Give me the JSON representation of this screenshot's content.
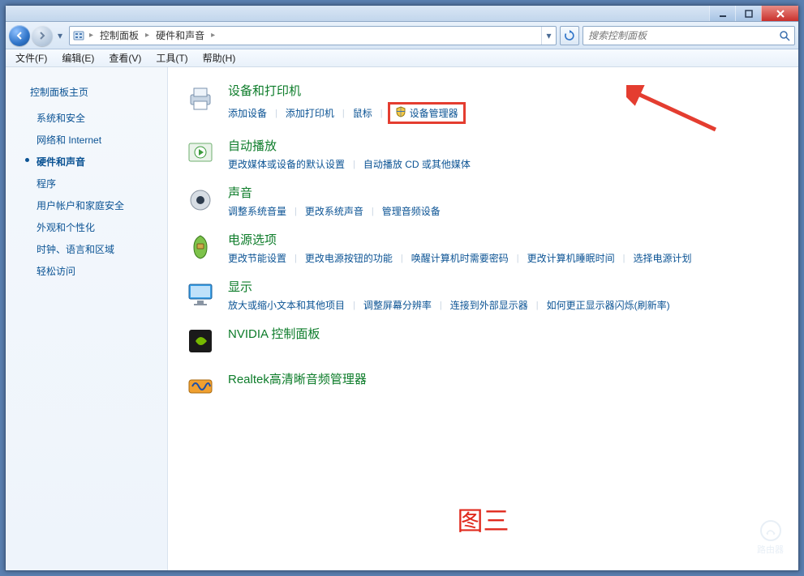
{
  "chrome": {
    "min_icon": "min",
    "max_icon": "max",
    "close_icon": "close"
  },
  "breadcrumb": {
    "root_icon": "control-panel",
    "level1": "控制面板",
    "level2": "硬件和声音"
  },
  "refresh_icon": "refresh",
  "search": {
    "placeholder": "搜索控制面板"
  },
  "menu": {
    "file": "文件(F)",
    "edit": "编辑(E)",
    "view": "查看(V)",
    "tools": "工具(T)",
    "help": "帮助(H)"
  },
  "sidebar": {
    "home": "控制面板主页",
    "items": [
      {
        "label": "系统和安全",
        "active": false
      },
      {
        "label": "网络和 Internet",
        "active": false
      },
      {
        "label": "硬件和声音",
        "active": true
      },
      {
        "label": "程序",
        "active": false
      },
      {
        "label": "用户帐户和家庭安全",
        "active": false
      },
      {
        "label": "外观和个性化",
        "active": false
      },
      {
        "label": "时钟、语言和区域",
        "active": false
      },
      {
        "label": "轻松访问",
        "active": false
      }
    ]
  },
  "categories": [
    {
      "icon": "printer",
      "title": "设备和打印机",
      "links": [
        {
          "t": "添加设备"
        },
        {
          "t": "添加打印机"
        },
        {
          "t": "鼠标"
        },
        {
          "t": "设备管理器",
          "shield": true,
          "highlight": true
        }
      ]
    },
    {
      "icon": "autoplay",
      "title": "自动播放",
      "links": [
        {
          "t": "更改媒体或设备的默认设置"
        },
        {
          "t": "自动播放 CD 或其他媒体"
        }
      ]
    },
    {
      "icon": "sound",
      "title": "声音",
      "links": [
        {
          "t": "调整系统音量"
        },
        {
          "t": "更改系统声音"
        },
        {
          "t": "管理音频设备"
        }
      ]
    },
    {
      "icon": "power",
      "title": "电源选项",
      "links": [
        {
          "t": "更改节能设置"
        },
        {
          "t": "更改电源按钮的功能"
        },
        {
          "t": "唤醒计算机时需要密码"
        },
        {
          "t": "更改计算机睡眠时间"
        },
        {
          "t": "选择电源计划"
        }
      ]
    },
    {
      "icon": "display",
      "title": "显示",
      "links": [
        {
          "t": "放大或缩小文本和其他项目"
        },
        {
          "t": "调整屏幕分辨率"
        },
        {
          "t": "连接到外部显示器"
        },
        {
          "t": "如何更正显示器闪烁(刷新率)"
        }
      ]
    },
    {
      "icon": "nvidia",
      "title": "NVIDIA 控制面板",
      "links": []
    },
    {
      "icon": "realtek",
      "title": "Realtek高清晰音频管理器",
      "links": []
    }
  ],
  "caption": "图三",
  "watermark": "路由器"
}
